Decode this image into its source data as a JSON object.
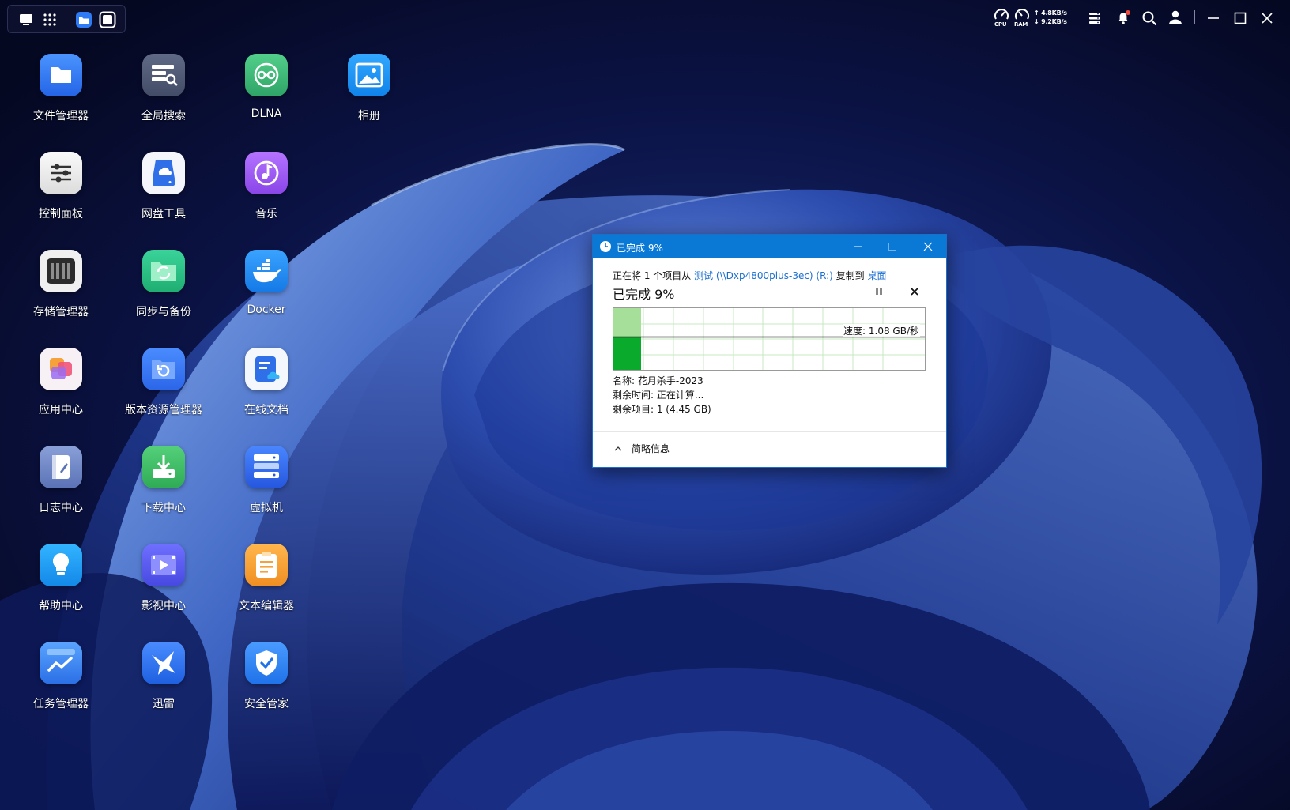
{
  "topbar": {
    "launcher_icons": [
      "monitor-icon",
      "apps-grid-icon",
      "file-manager-icon",
      "window-icon"
    ],
    "monitors": [
      {
        "label": "CPU",
        "icon": "gauge-icon"
      },
      {
        "label": "RAM",
        "icon": "gauge-icon"
      }
    ],
    "network": {
      "upload": "4.8KB/s",
      "download": "9.2KB/s"
    },
    "tray_icons": [
      "task-list-icon",
      "bell-icon",
      "search-icon",
      "user-icon"
    ],
    "window_controls": [
      "minimize-icon",
      "maximize-icon",
      "close-icon"
    ]
  },
  "desktop": {
    "apps": [
      {
        "label": "文件管理器",
        "icon": "folder-icon",
        "color": "#2f7bf5"
      },
      {
        "label": "全局搜索",
        "icon": "search-server-icon",
        "color": "#4d5870"
      },
      {
        "label": "DLNA",
        "icon": "dlna-icon",
        "color": "#3cb874"
      },
      {
        "label": "相册",
        "icon": "photo-icon",
        "color": "#2196f3"
      },
      {
        "label": "控制面板",
        "icon": "sliders-icon",
        "color": "#eeeeee"
      },
      {
        "label": "网盘工具",
        "icon": "cloud-drive-icon",
        "color": "#f4f6fb"
      },
      {
        "label": "音乐",
        "icon": "music-icon",
        "color": "#a05cf0"
      },
      {
        "label": "存储管理器",
        "icon": "storage-icon",
        "color": "#f0f0f0"
      },
      {
        "label": "同步与备份",
        "icon": "sync-folder-icon",
        "color": "#2bc48a"
      },
      {
        "label": "Docker",
        "icon": "docker-whale-icon",
        "color": "#1f8cf0"
      },
      {
        "label": "应用中心",
        "icon": "app-center-icon",
        "color": "#f6f0f4"
      },
      {
        "label": "版本资源管理器",
        "icon": "version-folder-icon",
        "color": "#2f7bf5"
      },
      {
        "label": "在线文档",
        "icon": "online-doc-icon",
        "color": "#f4f7fc"
      },
      {
        "label": "日志中心",
        "icon": "log-book-icon",
        "color": "#6e84c0"
      },
      {
        "label": "下载中心",
        "icon": "download-icon",
        "color": "#3fbf6a"
      },
      {
        "label": "虚拟机",
        "icon": "virtual-machine-icon",
        "color": "#2f6fe8"
      },
      {
        "label": "帮助中心",
        "icon": "bulb-icon",
        "color": "#1fa0f5"
      },
      {
        "label": "影视中心",
        "icon": "video-icon",
        "color": "#5b5cf0"
      },
      {
        "label": "文本编辑器",
        "icon": "notepad-icon",
        "color": "#f7a43a"
      },
      {
        "label": "任务管理器",
        "icon": "trend-icon",
        "color": "#3b8af5"
      },
      {
        "label": "迅雷",
        "icon": "thunder-bird-icon",
        "color": "#2f7bf5"
      },
      {
        "label": "安全管家",
        "icon": "shield-check-icon",
        "color": "#2f86f0"
      }
    ]
  },
  "copy_dialog": {
    "title": "已完成 9%",
    "title_icon": "clock-icon",
    "controls": [
      "minimize-icon",
      "maximize-icon",
      "close-icon"
    ],
    "status_prefix": "正在将 1 个项目从 ",
    "source": "测试 (\\\\Dxp4800plus-3ec) (R:)",
    "status_middle": " 复制到 ",
    "destination": "桌面",
    "progress_label": "已完成 9%",
    "progress_percent": 9,
    "speed": "速度: 1.08 GB/秒",
    "details": {
      "name": "名称: 花月杀手-2023",
      "time_remaining": "剩余时间: 正在计算...",
      "items_remaining": "剩余项目: 1 (4.45 GB)"
    },
    "less_details": "简略信息",
    "colors": {
      "titlebar": "#0a79d6",
      "progress_fill": "#0aaa2d",
      "progress_light": "#a6df9a",
      "link": "#1a6fd0"
    }
  }
}
